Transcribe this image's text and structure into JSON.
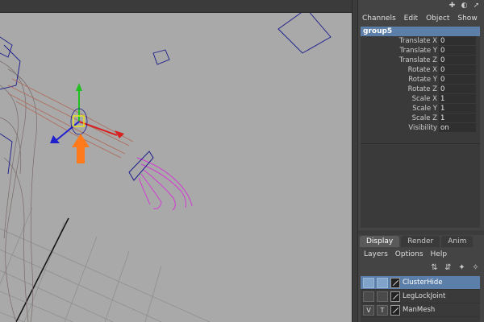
{
  "window": {
    "accent": "#5b7fa8"
  },
  "topbar_icons": [
    "grid-icon",
    "help-icon",
    "pin-icon"
  ],
  "channel_box": {
    "menu": [
      "Channels",
      "Edit",
      "Object",
      "Show"
    ],
    "object_name": "group5",
    "attributes": [
      {
        "label": "Translate X",
        "value": "0"
      },
      {
        "label": "Translate Y",
        "value": "0"
      },
      {
        "label": "Translate Z",
        "value": "0"
      },
      {
        "label": "Rotate X",
        "value": "0"
      },
      {
        "label": "Rotate Y",
        "value": "0"
      },
      {
        "label": "Rotate Z",
        "value": "0"
      },
      {
        "label": "Scale X",
        "value": "1"
      },
      {
        "label": "Scale Y",
        "value": "1"
      },
      {
        "label": "Scale Z",
        "value": "1"
      },
      {
        "label": "Visibility",
        "value": "on"
      }
    ]
  },
  "layer_editor": {
    "tabs": [
      "Display",
      "Render",
      "Anim"
    ],
    "active_tab": "Display",
    "menu": [
      "Layers",
      "Options",
      "Help"
    ],
    "layers": [
      {
        "name": "ClusterHide",
        "v": "",
        "t": "",
        "selected": true
      },
      {
        "name": "LegLockJoint",
        "v": "",
        "t": "",
        "selected": false
      },
      {
        "name": "ManMesh",
        "v": "V",
        "t": "T",
        "selected": false
      }
    ]
  },
  "viewport": {
    "background": "#a9a9a9",
    "gizmo_colors": {
      "x": "#d82020",
      "y": "#20c020",
      "z": "#2020d0"
    },
    "annotation_arrow": "#ff7a1a"
  }
}
